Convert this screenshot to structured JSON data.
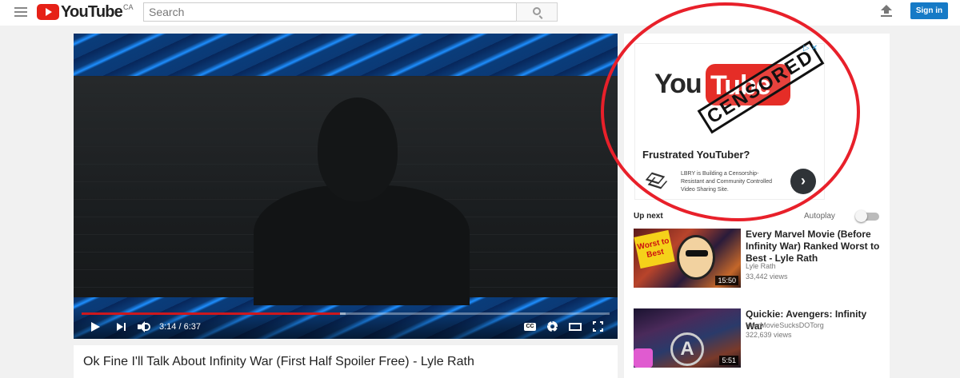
{
  "masthead": {
    "logo_text": "YouTube",
    "region": "CA",
    "search_placeholder": "Search",
    "signin_label": "Sign in"
  },
  "player": {
    "current_time": "3:14",
    "duration": "6:37",
    "time_display": "3:14 / 6:37",
    "progress_fraction": 0.49,
    "buffer_fraction": 0.5,
    "cc_label": "CC"
  },
  "video": {
    "title": "Ok Fine I'll Talk About Infinity War (First Half Spoiler Free) - Lyle Rath"
  },
  "ad": {
    "logo_you": "You",
    "logo_tube": "Tube",
    "stamp": "CENSORED",
    "headline": "Frustrated YouTuber?",
    "body": "LBRY is Building a Censorship-Resistant and Community Controlled Video Sharing Site.",
    "cta": "›"
  },
  "sidebar": {
    "up_next_label": "Up next",
    "autoplay_label": "Autoplay",
    "autoplay_on": false,
    "videos": [
      {
        "title": "Every Marvel Movie (Before Infinity War) Ranked Worst to Best - Lyle Rath",
        "channel": "Lyle Rath",
        "views": "33,442 views",
        "duration": "15:50",
        "badge": "Worst to Best"
      },
      {
        "title": "Quickie: Avengers: Infinity War",
        "channel": "YourMovieSucksDOTorg",
        "views": "322,639 views",
        "duration": "5:51",
        "badge": "A"
      }
    ]
  },
  "colors": {
    "brand_red": "#e62117",
    "signin_blue": "#167ac6",
    "progress_red": "#cc181e",
    "annotation_red": "#e8202a"
  }
}
